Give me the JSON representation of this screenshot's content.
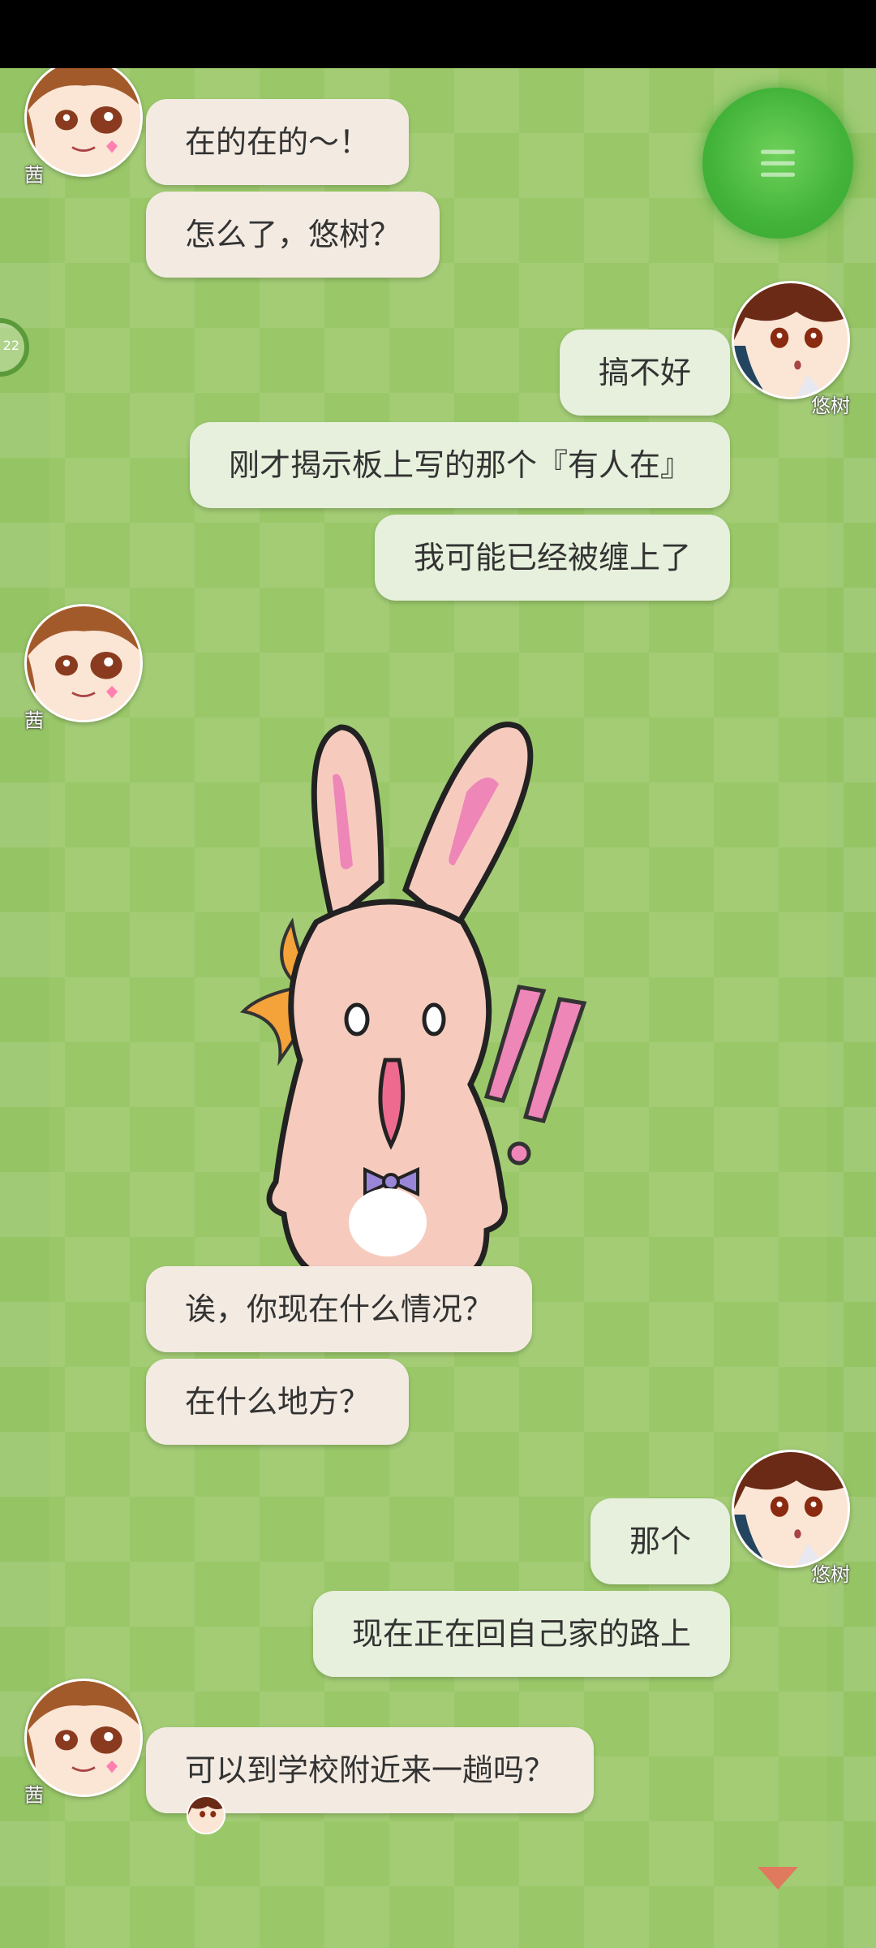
{
  "colors": {
    "background": "#95c465",
    "left_bubble": "#f3ebe2",
    "right_bubble": "#e6f0dc",
    "menu_button": "#42b339",
    "scroll_arrow": "#e07a5f"
  },
  "characters": {
    "akane": {
      "name": "茜"
    },
    "yuki": {
      "name": "悠树"
    }
  },
  "side_badge": {
    "text": "22"
  },
  "messages": [
    {
      "sender": "akane",
      "text": "在的在的～！"
    },
    {
      "sender": "akane",
      "text": "怎么了，悠树？"
    },
    {
      "sender": "yuki",
      "text": "搞不好"
    },
    {
      "sender": "yuki",
      "text": "刚才揭示板上写的那个『有人在』"
    },
    {
      "sender": "yuki",
      "text": "我可能已经被缠上了"
    },
    {
      "sender": "akane",
      "type": "sticker",
      "sticker": "rabbit-surprised"
    },
    {
      "sender": "akane",
      "text": "诶，你现在什么情况？"
    },
    {
      "sender": "akane",
      "text": "在什么地方？"
    },
    {
      "sender": "yuki",
      "text": "那个"
    },
    {
      "sender": "yuki",
      "text": "现在正在回自己家的路上"
    },
    {
      "sender": "akane",
      "text": "可以到学校附近来一趟吗？"
    }
  ],
  "icons": {
    "menu": "hamburger-menu-icon",
    "scroll": "triangle-down-icon"
  }
}
